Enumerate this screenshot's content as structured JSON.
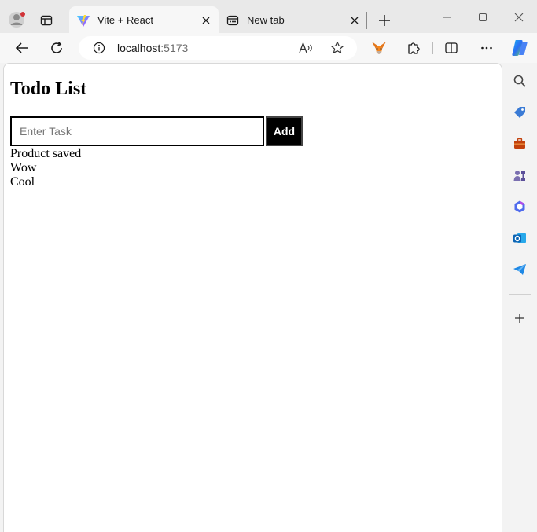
{
  "browser": {
    "tabs": [
      {
        "title": "Vite + React",
        "active": true,
        "icon": "vite-logo-icon"
      },
      {
        "title": "New tab",
        "active": false,
        "icon": "new-tab-page-icon"
      }
    ],
    "address": {
      "host": "localhost",
      "port": ":5173"
    }
  },
  "app": {
    "heading": "Todo List",
    "input": {
      "placeholder": "Enter Task",
      "value": ""
    },
    "add_label": "Add",
    "todos": [
      "Product saved",
      "Wow",
      "Cool"
    ]
  },
  "sidebar": {
    "items": [
      "search-icon",
      "shopping-tag-icon",
      "tools-briefcase-icon",
      "games-chess-icon",
      "copilot-m365-icon",
      "outlook-icon",
      "telegram-send-icon",
      "add-icon"
    ]
  },
  "colors": {
    "accent": "#0078d4",
    "button_bg": "#000000"
  }
}
